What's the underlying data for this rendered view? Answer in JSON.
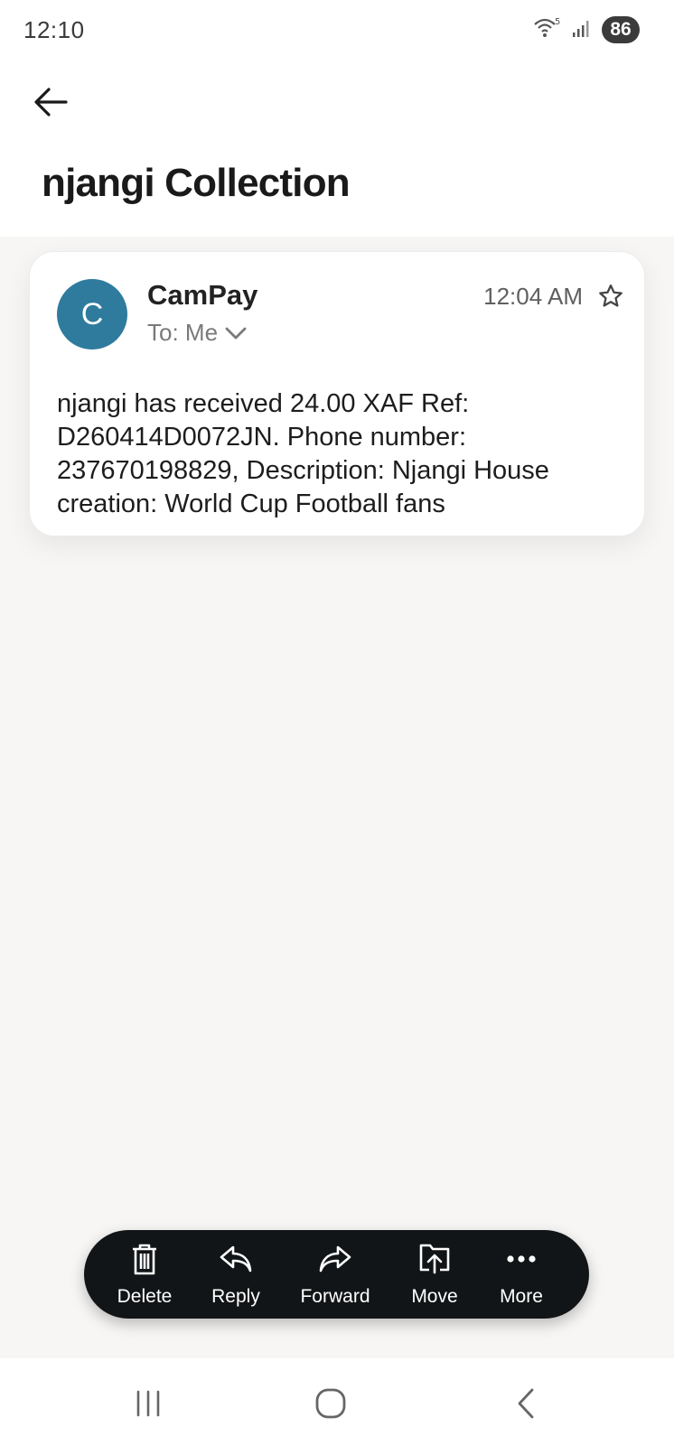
{
  "status_bar": {
    "time": "12:10",
    "wifi_label": "5",
    "battery": "86"
  },
  "header": {
    "title": "njangi Collection",
    "back_icon": "arrow-left-icon"
  },
  "message": {
    "avatar_letter": "C",
    "avatar_color": "#2e7b9e",
    "sender": "CamPay",
    "recipient": "To: Me",
    "time": "12:04 AM",
    "starred": false,
    "body": "njangi has received 24.00 XAF Ref: D260414D0072JN. Phone number: 237670198829, Description: Njangi House creation: World Cup Football fans"
  },
  "actions": [
    {
      "label": "Delete",
      "icon": "trash-icon"
    },
    {
      "label": "Reply",
      "icon": "reply-icon"
    },
    {
      "label": "Forward",
      "icon": "forward-icon"
    },
    {
      "label": "Move",
      "icon": "move-icon"
    },
    {
      "label": "More",
      "icon": "more-icon"
    }
  ],
  "nav_bar": {
    "buttons": [
      "recents-icon",
      "home-icon",
      "back-icon"
    ]
  },
  "colors": {
    "background": "#f7f6f5",
    "action_bar": "#121517",
    "avatar": "#2e7b9e"
  }
}
